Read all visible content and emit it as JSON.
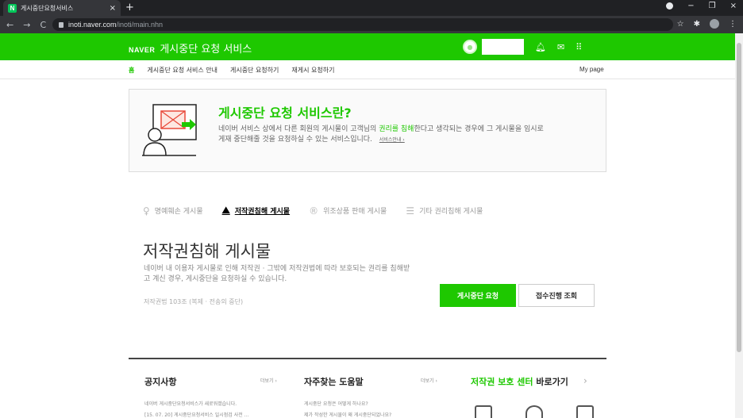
{
  "browser": {
    "tab_title": "게시중단요청서비스",
    "tab_favicon": "N",
    "tab_close": "×",
    "new_tab": "+",
    "url_host": "inoti.naver.com",
    "url_path": "/inoti/main.nhn",
    "nav_back": "←",
    "nav_forward": "→",
    "nav_reload": "C",
    "win_min": "−",
    "win_max": "❐",
    "win_close": "×",
    "star": "☆",
    "extensions": "✱",
    "menu": "⋮"
  },
  "header": {
    "logo": "NAVER",
    "service_title": "게시중단 요청 서비스",
    "bell_icon": "bell-icon",
    "mail_icon": "mail-icon",
    "apps_icon": "apps-icon"
  },
  "subnav": {
    "items": [
      {
        "label": "홈",
        "active": true
      },
      {
        "label": "게시중단 요청 서비스 안내"
      },
      {
        "label": "게시중단 요청하기"
      },
      {
        "label": "재게시 요청하기"
      }
    ],
    "mypage": "My page"
  },
  "intro": {
    "title": "게시중단 요청 서비스란?",
    "desc_prefix": "네이버 서비스 상에서 다른 회원의 게시물이 고객님의 ",
    "desc_highlight": "권리를 침해",
    "desc_suffix": "한다고 생각되는 경우에 그 게시물을 임시로",
    "desc_line2": "게재 중단해줄 것을 요청하실 수 있는 서비스입니다.",
    "more_link": "서비스안내 ›"
  },
  "categories": [
    {
      "label": "명예훼손 게시물",
      "icon": "person-icon",
      "glyph": "♀",
      "active": false
    },
    {
      "label": "저작권침해 게시물",
      "icon": "pen-icon",
      "glyph": "⛰",
      "active": true
    },
    {
      "label": "위조상품 판매 게시물",
      "icon": "registered-icon",
      "glyph": "®",
      "active": false
    },
    {
      "label": "기타 권리침해 게시물",
      "icon": "clipboard-icon",
      "glyph": "☰",
      "active": false
    }
  ],
  "section": {
    "title": "저작권침해 게시물",
    "desc": "네이버 내 이용자 게시물로 인해 저작권 · 그밖에 저작권법에 따라 보호되는 권리를 침해받고 계신 경우, 게시중단을 요청하실 수 있습니다.",
    "law": "저작권법 103조 (복제 · 전송의 중단)",
    "btn_request": "게시중단 요청",
    "btn_status": "접수진행 조회"
  },
  "footer": {
    "notice": {
      "title": "공지사항",
      "more": "더보기 ›",
      "items": [
        "네이버 게시중단요청서비스가 새로워졌습니다.",
        "[15. 07. 20] 게시중단요청서비스 일시점검 사전 ..."
      ]
    },
    "faq": {
      "title": "자주찾는 도움말",
      "more": "더보기 ›",
      "items": [
        "게시중단 요청은 어떻게 하나요?",
        "제가 작성한 게시물이 왜 게시중단되었나요?"
      ]
    },
    "shortcut": {
      "title_green": "저작권 보호 센터",
      "title_rest": " 바로가기",
      "arrow": "›"
    }
  }
}
